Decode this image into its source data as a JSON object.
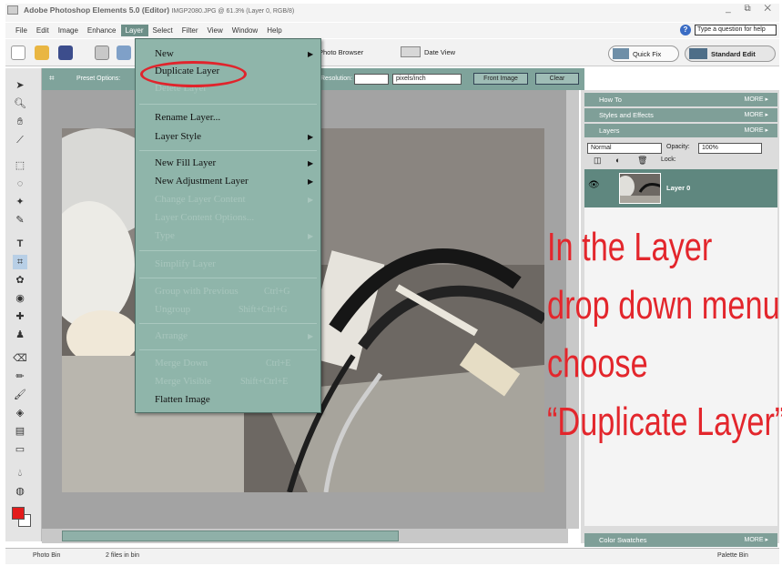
{
  "window": {
    "title": "Adobe Photoshop Elements 5.0 (Editor)",
    "doc_info": "IMGP2080.JPG @ 61.3% (Layer 0, RGB/8)",
    "controls": "_ ⧉ ✕"
  },
  "menubar": {
    "items": [
      "File",
      "Edit",
      "Image",
      "Enhance",
      "Layer",
      "Select",
      "Filter",
      "View",
      "Window",
      "Help"
    ],
    "active": "Layer",
    "help_placeholder": "Type a question for help"
  },
  "toolbar": {
    "photo_browser": "Photo Browser",
    "date_view": "Date View",
    "quick_fix": "Quick Fix",
    "standard_edit": "Standard Edit"
  },
  "options_bar": {
    "preset_label": "Preset Options:",
    "resolution_label": "Resolution:",
    "units": "pixels/inch",
    "front_image": "Front Image",
    "clear": "Clear"
  },
  "layer_menu": {
    "new": "New",
    "duplicate_layer": "Duplicate Layer",
    "delete_layer": "Delete Layer",
    "rename_layer": "Rename Layer...",
    "layer_style": "Layer Style",
    "new_fill_layer": "New Fill Layer",
    "new_adjustment_layer": "New Adjustment Layer",
    "change_layer_content": "Change Layer Content",
    "layer_content_options": "Layer Content Options...",
    "type": "Type",
    "simplify_layer": "Simplify Layer",
    "group_with_previous": "Group with Previous",
    "group_with_previous_shortcut": "Ctrl+G",
    "ungroup": "Ungroup",
    "ungroup_shortcut": "Shift+Ctrl+G",
    "arrange": "Arrange",
    "merge_down": "Merge Down",
    "merge_down_shortcut": "Ctrl+E",
    "merge_visible": "Merge Visible",
    "merge_visible_shortcut": "Shift+Ctrl+E",
    "flatten_image": "Flatten Image"
  },
  "palettes": {
    "how_to": "How To",
    "styles_effects": "Styles and Effects",
    "layers": "Layers",
    "more": "MORE ▸",
    "blend_mode": "Normal",
    "opacity_label": "Opacity:",
    "opacity_value": "100%",
    "lock_label": "Lock:",
    "layer_name": "Layer 0",
    "color_swatches": "Color Swatches"
  },
  "statusbar": {
    "photo_bin": "Photo Bin",
    "files": "2 files in bin",
    "palette_bin": "Palette Bin"
  },
  "annotation": {
    "line1": "In the Layer",
    "line2": "drop down menu,",
    "line3": "choose",
    "line4": "“Duplicate Layer”"
  },
  "colors": {
    "accent": "#7f9f98",
    "menu_bg": "#8fb5aa",
    "annotation": "#e3262c",
    "foreground_swatch": "#e31b1b"
  }
}
